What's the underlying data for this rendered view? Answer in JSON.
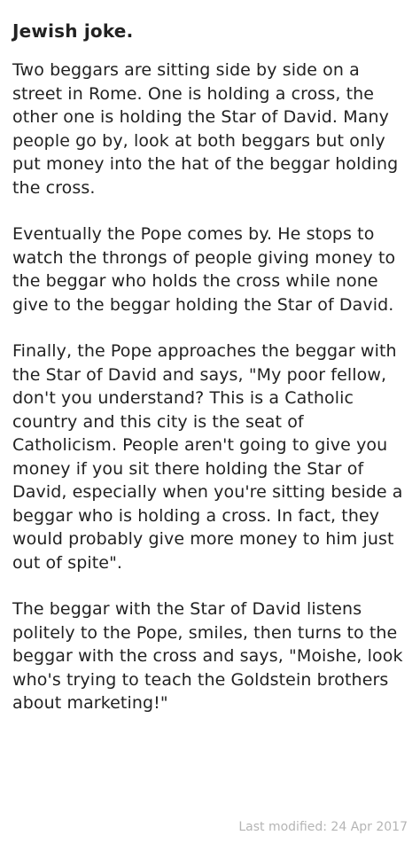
{
  "note": {
    "title": "Jewish joke.",
    "paragraphs": [
      "Two beggars are sitting side by side on a street in Rome. One is holding a cross, the other one is holding the Star of David. Many people go by, look at both beggars but only put money into the hat of the beggar holding the cross.",
      "Eventually the Pope comes by. He stops to watch the throngs of people giving money to the beggar who holds the cross while none give to the beggar holding the Star of David.",
      "Finally, the Pope approaches the beggar with the Star of David and says, \"My poor fellow, don't you understand? This is a Catholic country and this city is the seat of Catholicism. People aren't going to give you money if you sit there holding the Star of David, especially when you're sitting beside a beggar who is holding a cross. In fact, they would probably give more money to him just out of spite\".",
      "The beggar with the Star of David listens politely to the Pope, smiles, then turns to the beggar with the cross and says, \"Moishe, look who's trying to teach the Goldstein brothers about marketing!\""
    ],
    "footer": "Last modified: 24 Apr 2017"
  }
}
